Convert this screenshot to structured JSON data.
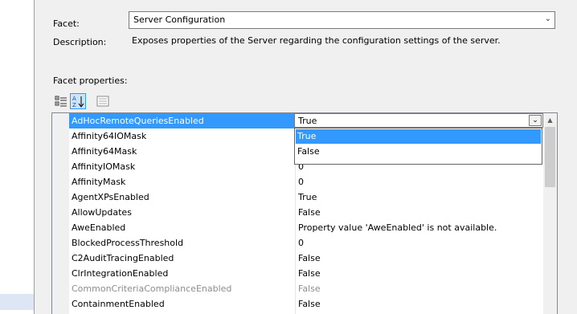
{
  "facet": {
    "label": "Facet:",
    "value": "Server Configuration"
  },
  "description": {
    "label": "Description:",
    "text": "Exposes properties of the Server regarding the configuration settings of the server."
  },
  "facet_properties_label": "Facet properties:",
  "toolbar": {
    "categorized_icon": "categorized-icon",
    "alphabetical_icon": "sort-alphabetical-icon",
    "property_pages_icon": "property-pages-icon"
  },
  "grid": {
    "rows": [
      {
        "name": "AdHocRemoteQueriesEnabled",
        "value": ""
      },
      {
        "name": "Affinity64IOMask",
        "value": ""
      },
      {
        "name": "Affinity64Mask",
        "value": ""
      },
      {
        "name": "AffinityIOMask",
        "value": "0"
      },
      {
        "name": "AffinityMask",
        "value": "0"
      },
      {
        "name": "AgentXPsEnabled",
        "value": "True"
      },
      {
        "name": "AllowUpdates",
        "value": "False"
      },
      {
        "name": "AweEnabled",
        "value": "Property value 'AweEnabled' is not available."
      },
      {
        "name": "BlockedProcessThreshold",
        "value": "0"
      },
      {
        "name": "C2AuditTracingEnabled",
        "value": "False"
      },
      {
        "name": "ClrIntegrationEnabled",
        "value": "False"
      },
      {
        "name": "CommonCriteriaComplianceEnabled",
        "value": "False"
      },
      {
        "name": "ContainmentEnabled",
        "value": "False"
      }
    ]
  },
  "editor": {
    "value": "True",
    "options": [
      "True",
      "False"
    ]
  },
  "colors": {
    "selection": "#3399ff",
    "disabled_text": "#8c8c8c"
  }
}
